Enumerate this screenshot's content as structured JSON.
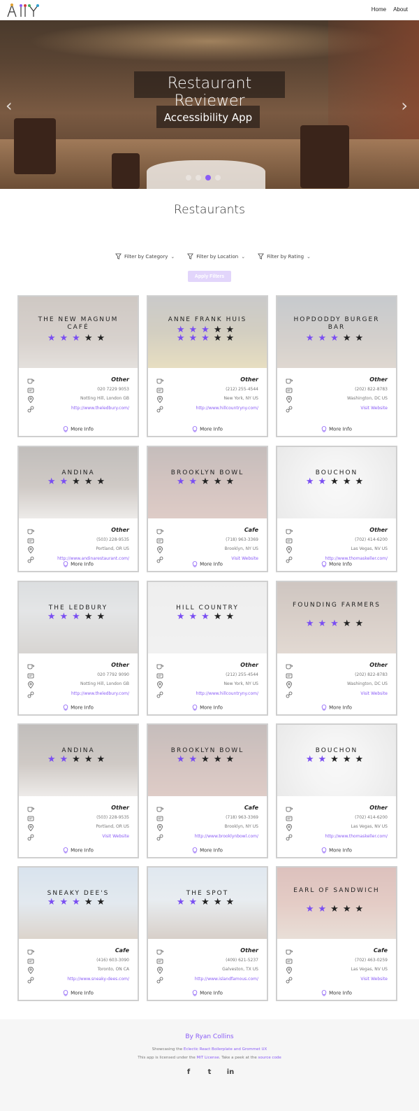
{
  "nav": {
    "logo_text": "A11Y",
    "links": [
      "Home",
      "About"
    ]
  },
  "hero": {
    "title": "Restaurant Reviewer",
    "subtitle": "Accessibility App",
    "prev_icon": "chevron-left-icon",
    "next_icon": "chevron-right-icon",
    "slides": 4,
    "active_slide": 3
  },
  "section_title": "Restaurants",
  "filters": {
    "items": [
      "Filter by Category",
      "Filter by Location",
      "Filter by Rating"
    ],
    "apply_label": "Apply Filters"
  },
  "more_label": "More Info",
  "colors": {
    "accent": "#8a5cf6",
    "star_on": "#7a4ef2",
    "star_off": "#222222"
  },
  "restaurants": [
    {
      "name": "The New Magnum Café",
      "rating": 3,
      "category": "Other",
      "phone": "020 7229 9053",
      "location": "Notting Hill, London GB",
      "website": "http://www.theledbury.com/"
    },
    {
      "name": "Anne Frank Huis",
      "rating": 3,
      "category": "Other",
      "phone": "(212) 255-4544",
      "location": "New York, NY US",
      "website": "http://www.hillcountryny.com/"
    },
    {
      "name": "Hopdoddy Burger Bar",
      "rating": 3,
      "category": "Other",
      "phone": "(202) 822-8783",
      "location": "Washington, DC US",
      "website": "Visit Website"
    },
    {
      "name": "Andina",
      "rating": 2,
      "category": "Other",
      "phone": "(503) 228-9535",
      "location": "Portland, OR US",
      "website": "http://www.andinarestaurant.com/"
    },
    {
      "name": "Brooklyn Bowl",
      "rating": 2,
      "category": "Cafe",
      "phone": "(718) 963-3369",
      "location": "Brooklyn, NY US",
      "website": "Visit Website"
    },
    {
      "name": "Bouchon",
      "rating": 2,
      "category": "Other",
      "phone": "(702) 414-6200",
      "location": "Las Vegas, NV US",
      "website": "http://www.thomaskeller.com/"
    },
    {
      "name": "The Ledbury",
      "rating": 3,
      "category": "Other",
      "phone": "020 7792 9090",
      "location": "Notting Hill, London GB",
      "website": "http://www.theledbury.com/"
    },
    {
      "name": "Hill Country",
      "rating": 3,
      "category": "Other",
      "phone": "(212) 255-4544",
      "location": "New York, NY US",
      "website": "http://www.hillcountryny.com/"
    },
    {
      "name": "Founding Farmers",
      "rating": 3,
      "category": "Other",
      "phone": "(202) 822-8783",
      "location": "Washington, DC US",
      "website": "Visit Website"
    },
    {
      "name": "Andina",
      "rating": 2,
      "category": "Other",
      "phone": "(503) 228-9535",
      "location": "Portland, OR US",
      "website": "Visit Website"
    },
    {
      "name": "Brooklyn Bowl",
      "rating": 2,
      "category": "Cafe",
      "phone": "(718) 963-3369",
      "location": "Brooklyn, NY US",
      "website": "http://www.brooklynbowl.com/"
    },
    {
      "name": "Bouchon",
      "rating": 2,
      "category": "Other",
      "phone": "(702) 414-6200",
      "location": "Las Vegas, NV US",
      "website": "http://www.thomaskeller.com/"
    },
    {
      "name": "Sneaky Dee's",
      "rating": 3,
      "category": "Cafe",
      "phone": "(416) 603-3090",
      "location": "Toronto, ON CA",
      "website": "http://www.sneaky-dees.com/"
    },
    {
      "name": "The Spot",
      "rating": 2,
      "category": "Other",
      "phone": "(409) 621-5237",
      "location": "Galveston, TX US",
      "website": "http://www.islandfamous.com/"
    },
    {
      "name": "Earl of Sandwich",
      "rating": 2,
      "category": "Cafe",
      "phone": "(702) 463-0259",
      "location": "Las Vegas, NV US",
      "website": "Visit Website"
    }
  ],
  "footer": {
    "by_prefix": "By ",
    "author": "Ryan Collins",
    "line1_prefix": "Showcasing the ",
    "line1_link": "Eclectic React Boilerplate and Grommet UX",
    "line2_prefix": "This app is licensed under the ",
    "line2_link1": "MIT License",
    "line2_mid": ". Take a peek at the ",
    "line2_link2": "source code",
    "social": [
      "f",
      "t",
      "in"
    ]
  }
}
